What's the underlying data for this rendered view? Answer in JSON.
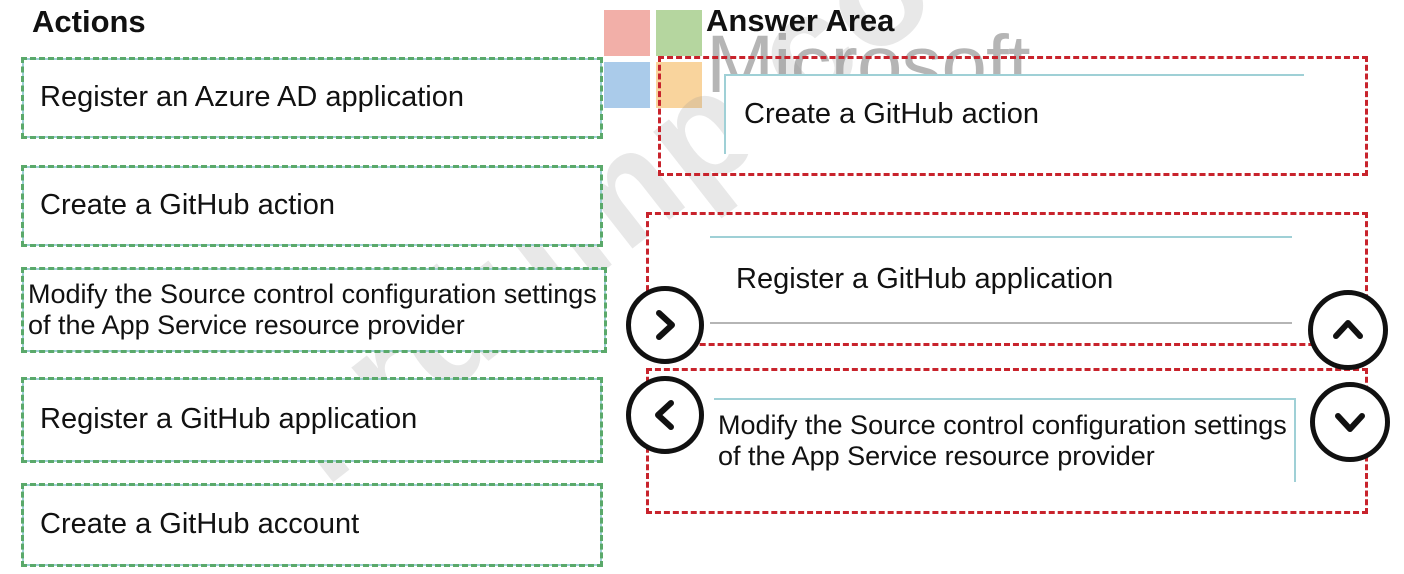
{
  "actions_panel": {
    "title": "Actions",
    "items": [
      {
        "label": "Register an Azure AD application"
      },
      {
        "label": "Create a GitHub action"
      },
      {
        "label": "Modify the Source control configuration settings of the App Service resource provider"
      },
      {
        "label": "Register a GitHub application"
      },
      {
        "label": "Create a GitHub account"
      }
    ]
  },
  "answer_area": {
    "title": "Answer Area",
    "items": [
      {
        "label": "Create a GitHub action"
      },
      {
        "label": "Register a GitHub application"
      },
      {
        "label": "Modify the Source control configuration settings of the App Service resource provider"
      }
    ]
  },
  "controls": {
    "move_right": "chevron-right-icon",
    "move_left": "chevron-left-icon",
    "move_up": "chevron-up-icon",
    "move_down": "chevron-down-icon"
  },
  "watermark": {
    "brand": "Microsoft",
    "site": "krdump.com"
  },
  "colors": {
    "actions_border": "#5aa96a",
    "answer_slot_border": "#c8232c",
    "item_border": "#9fd0d6",
    "logo_red": "#f0a29a",
    "logo_green": "#a9cf8f",
    "logo_blue": "#9cc3e7",
    "logo_yellow": "#f8cd8c"
  }
}
